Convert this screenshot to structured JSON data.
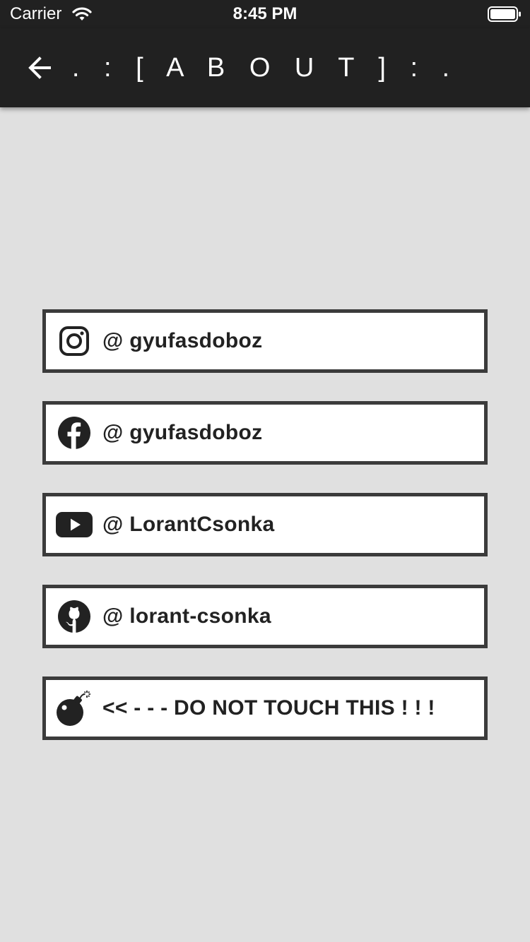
{
  "status_bar": {
    "carrier": "Carrier",
    "time": "8:45 PM",
    "icons": [
      "wifi-icon",
      "battery-icon"
    ]
  },
  "app_bar": {
    "title": ". : [ A B O U T ] : .",
    "back_icon": "arrow-left-icon",
    "background": "#212121"
  },
  "links": [
    {
      "icon": "instagram-icon",
      "label": "@ gyufasdoboz"
    },
    {
      "icon": "facebook-icon",
      "label": "@ gyufasdoboz"
    },
    {
      "icon": "youtube-icon",
      "label": "@ LorantCsonka"
    },
    {
      "icon": "github-icon",
      "label": "@ lorant-csonka"
    },
    {
      "icon": "bomb-icon",
      "label": "<< - - - DO NOT TOUCH THIS ! ! !"
    }
  ],
  "colors": {
    "background": "#e0e0e0",
    "card_border": "#3b3b3b",
    "card_fill": "#ffffff",
    "text": "#222222"
  }
}
